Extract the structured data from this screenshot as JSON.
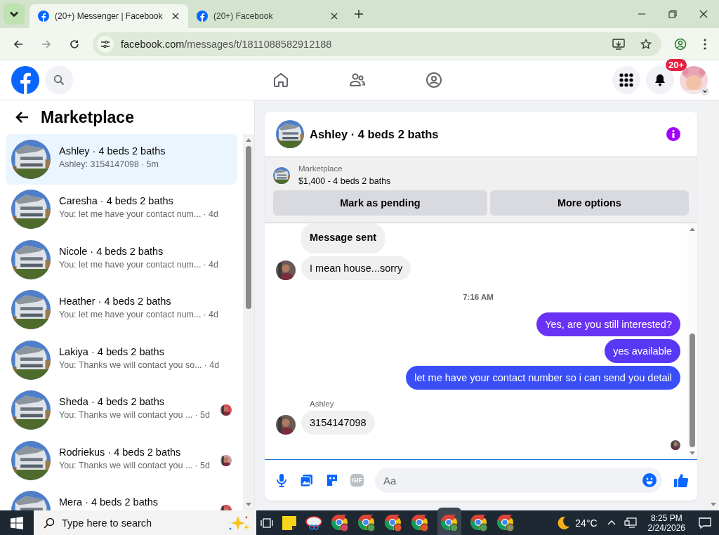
{
  "browser": {
    "tabs": [
      {
        "title": "(20+) Messenger | Facebook",
        "selected": true
      },
      {
        "title": "(20+) Facebook",
        "selected": false
      }
    ],
    "url_domain": "facebook.com",
    "url_path": "/messages/t/1811088582912188"
  },
  "nav": {
    "notification_badge": "20+"
  },
  "sidebar": {
    "title": "Marketplace",
    "conversations": [
      {
        "name": "Ashley · 4 beds 2 baths",
        "preview": "Ashley: 3154147098",
        "time": "· 5m",
        "selected": true,
        "seen_avatar": false
      },
      {
        "name": "Caresha · 4 beds 2 baths",
        "preview": "You: let me have your contact num...",
        "time": "· 4d",
        "selected": false,
        "seen_avatar": false
      },
      {
        "name": "Nicole · 4 beds 2 baths",
        "preview": "You: let me have your contact num...",
        "time": "· 4d",
        "selected": false,
        "seen_avatar": false
      },
      {
        "name": "Heather · 4 beds 2 baths",
        "preview": "You: let me have your contact num...",
        "time": "· 4d",
        "selected": false,
        "seen_avatar": false
      },
      {
        "name": "Lakiya · 4 beds 2 baths",
        "preview": "You: Thanks we will contact you so...",
        "time": "· 4d",
        "selected": false,
        "seen_avatar": false
      },
      {
        "name": "Sheda · 4 beds 2 baths",
        "preview": "You: Thanks we will contact you ...",
        "time": "· 5d",
        "selected": false,
        "seen_avatar": true
      },
      {
        "name": "Rodriekus · 4 beds 2 baths",
        "preview": "You: Thanks we will contact you ...",
        "time": "· 5d",
        "selected": false,
        "seen_avatar": true
      },
      {
        "name": "Mera · 4 beds 2 baths",
        "selected": false,
        "seen_avatar": true
      }
    ]
  },
  "chat": {
    "title": "Ashley · 4 beds 2 baths",
    "listing": {
      "label": "Marketplace",
      "item": "$1,400 - 4 beds 2 baths"
    },
    "actions": [
      "Mark as pending",
      "More options"
    ],
    "messages": [
      {
        "kind": "received",
        "text": "Message sent",
        "bold": true,
        "avatar": false
      },
      {
        "kind": "received",
        "text": "I mean house...sorry",
        "bold": false,
        "avatar": true
      },
      {
        "kind": "time",
        "text": "7:16 AM"
      },
      {
        "kind": "sent",
        "text": "Yes, are you still interested?"
      },
      {
        "kind": "sent",
        "text": "yes available"
      },
      {
        "kind": "sent",
        "text": "let me have your contact number so i can send you detail"
      },
      {
        "kind": "sender",
        "text": "Ashley"
      },
      {
        "kind": "received",
        "text": "3154147098",
        "bold": false,
        "avatar": true
      }
    ],
    "seen": true,
    "composer": {
      "placeholder": "Aa",
      "gif": "GIF"
    }
  },
  "taskbar": {
    "search_placeholder": "Type here to search",
    "weather": "24°C",
    "time": "8:25 PM",
    "date": "2/24/2026"
  }
}
